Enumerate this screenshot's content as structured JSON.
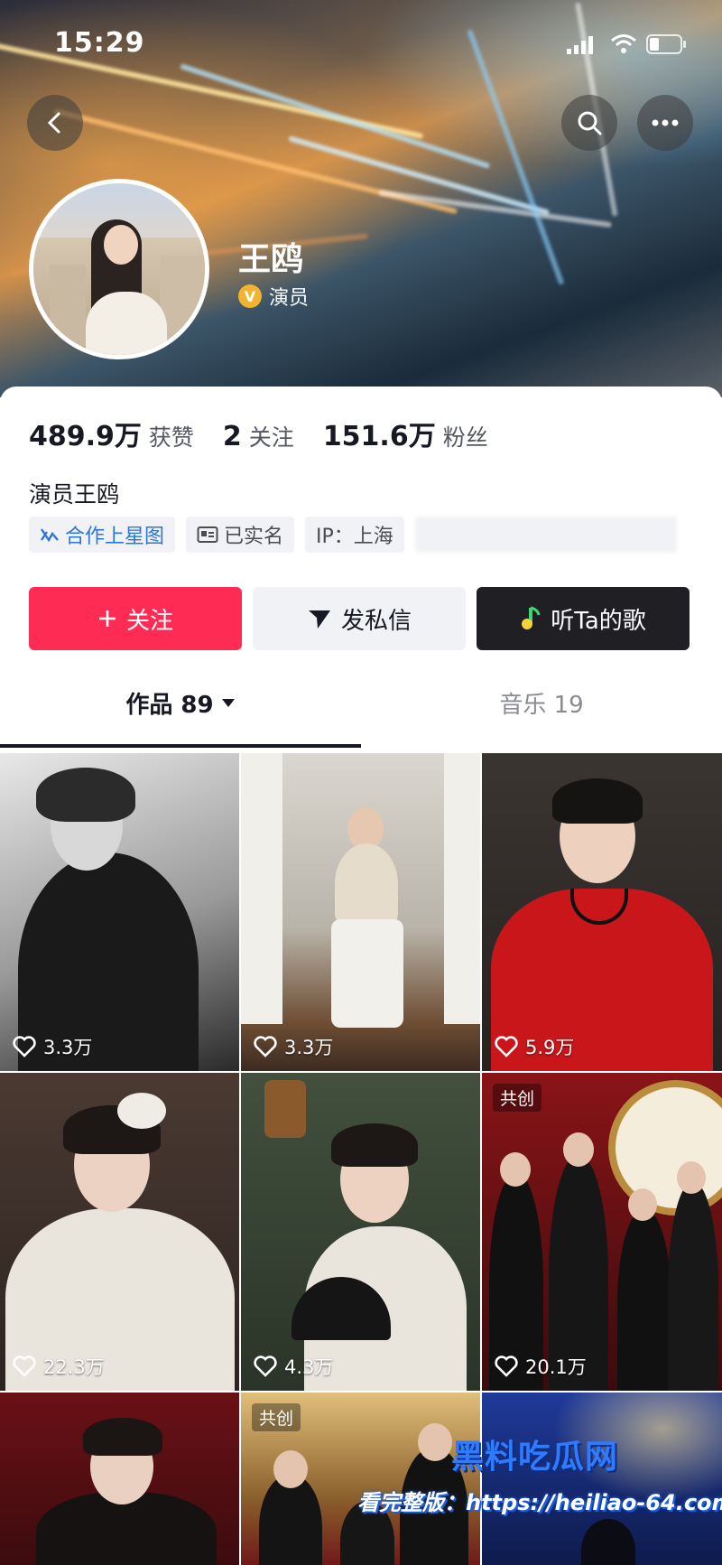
{
  "status": {
    "time": "15:29"
  },
  "profile": {
    "name": "王鸥",
    "verification": "演员",
    "bio": "演员王鸥"
  },
  "stats": [
    {
      "value": "489.9万",
      "label": "获赞"
    },
    {
      "value": "2",
      "label": "关注"
    },
    {
      "value": "151.6万",
      "label": "粉丝"
    }
  ],
  "tags": {
    "star_map": "合作上星图",
    "real_name": "已实名",
    "ip": "IP：上海"
  },
  "actions": {
    "follow": "关注",
    "message": "发私信",
    "music": "听Ta的歌"
  },
  "tabs": {
    "works": "作品 89",
    "music": "音乐 19"
  },
  "videos": [
    {
      "likes": "3.3万",
      "cocreate": ""
    },
    {
      "likes": "3.3万",
      "cocreate": ""
    },
    {
      "likes": "5.9万",
      "cocreate": ""
    },
    {
      "likes": "22.3万",
      "cocreate": ""
    },
    {
      "likes": "4.3万",
      "cocreate": ""
    },
    {
      "likes": "20.1万",
      "cocreate": "共创"
    },
    {
      "likes": "",
      "cocreate": ""
    },
    {
      "likes": "",
      "cocreate": "共创"
    },
    {
      "likes": "",
      "cocreate": ""
    }
  ],
  "watermark": {
    "site": "黑料吃瓜网",
    "url_line": "看完整版：https://heiliao-64.com"
  },
  "colors": {
    "accent": "#fe2c55",
    "link": "#2c76d8",
    "verified": "#f2b430"
  }
}
